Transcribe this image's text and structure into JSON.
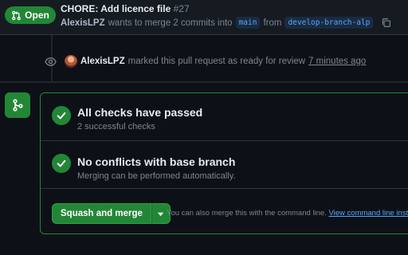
{
  "header": {
    "state_label": "Open",
    "title": "CHORE: Add licence file",
    "number": "#27",
    "author": "AlexisLPZ",
    "merge_text": "wants to merge 2 commits into",
    "base_branch": "main",
    "from_text": "from",
    "head_branch": "develop-branch-alp"
  },
  "event": {
    "author": "AlexisLPZ",
    "text": "marked this pull request as ready for review",
    "when": "7 minutes ago"
  },
  "merge_box": {
    "checks_title": "All checks have passed",
    "checks_sub": "2 successful checks",
    "conflicts_title": "No conflicts with base branch",
    "conflicts_sub": "Merging can be performed automatically.",
    "merge_button": "Squash and merge",
    "cmd_text": "You can also merge this with the command line.",
    "cmd_link": "View command line inst"
  },
  "colors": {
    "accent_green": "#238636",
    "link_blue": "#58a6ff",
    "background": "#0d1117"
  },
  "icons": [
    "git-pull-request-icon",
    "copy-icon",
    "eye-icon",
    "git-merge-icon",
    "check-icon",
    "triangle-down-icon"
  ]
}
